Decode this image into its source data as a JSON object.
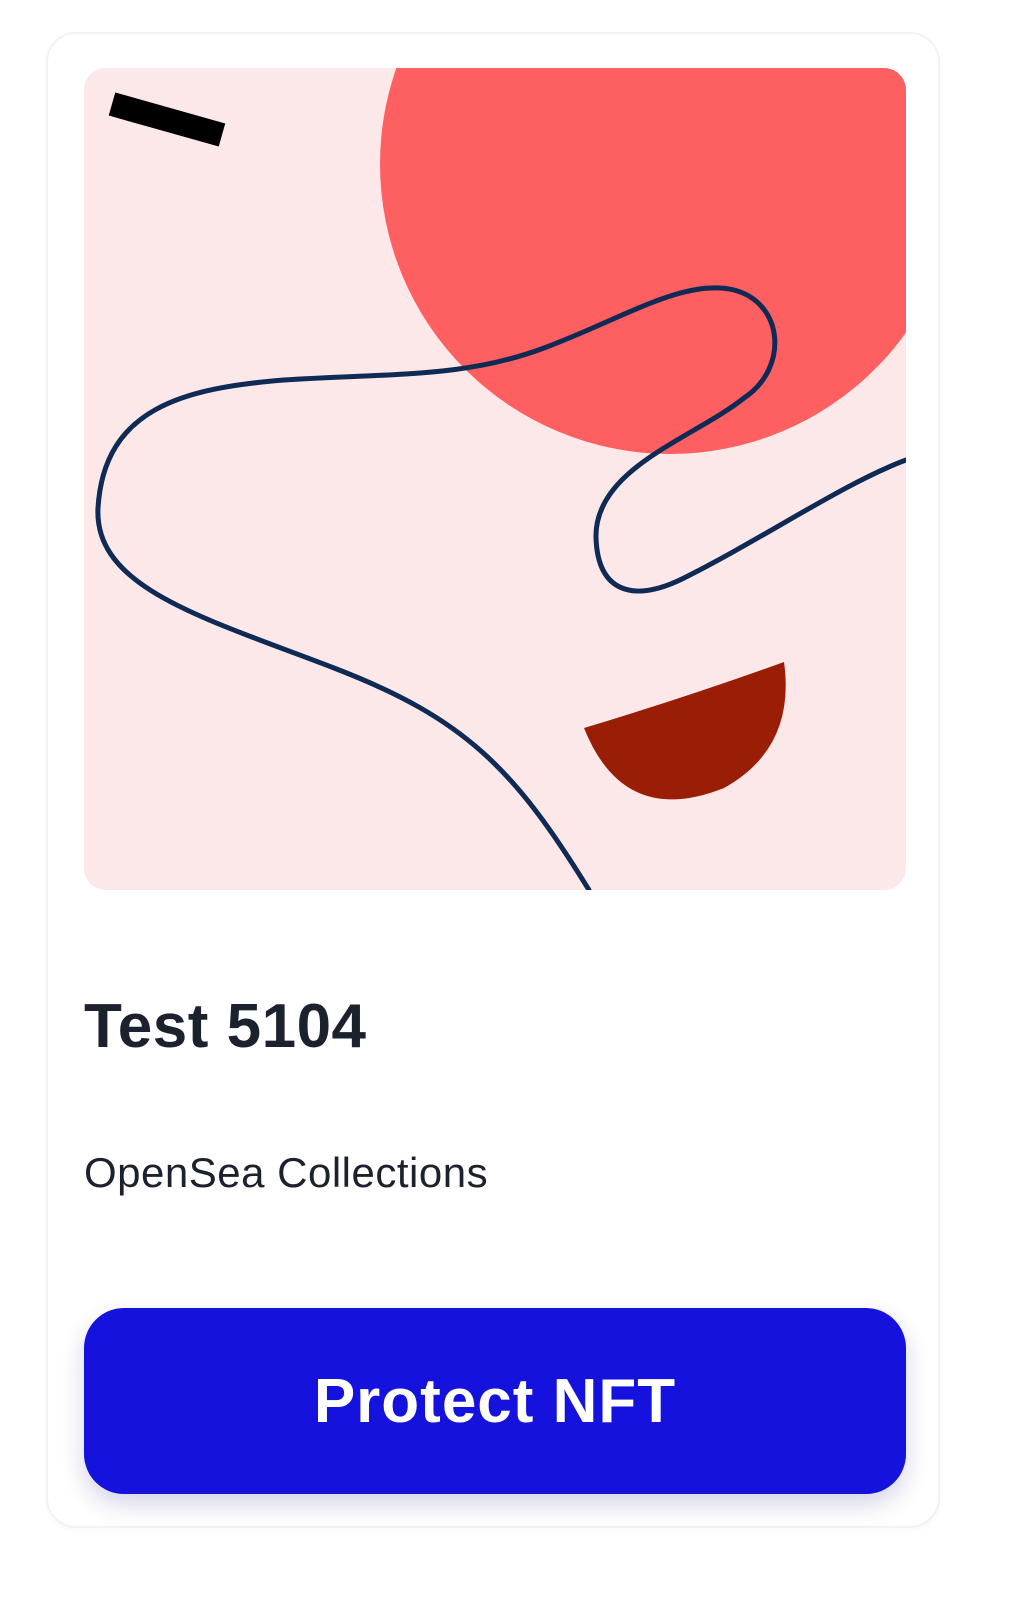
{
  "nft_card": {
    "title": "Test 5104",
    "collection": "OpenSea Collections",
    "action_label": "Protect NFT"
  },
  "artwork": {
    "background_color": "#fde8e9",
    "circle_color": "#fe5f61",
    "half_disc_color": "#9a1d05",
    "line_color": "#0f2a55",
    "dash_color": "#000000"
  },
  "colors": {
    "title_text": "#1b222e",
    "button_background": "#1412dc",
    "button_text": "#ffffff"
  }
}
